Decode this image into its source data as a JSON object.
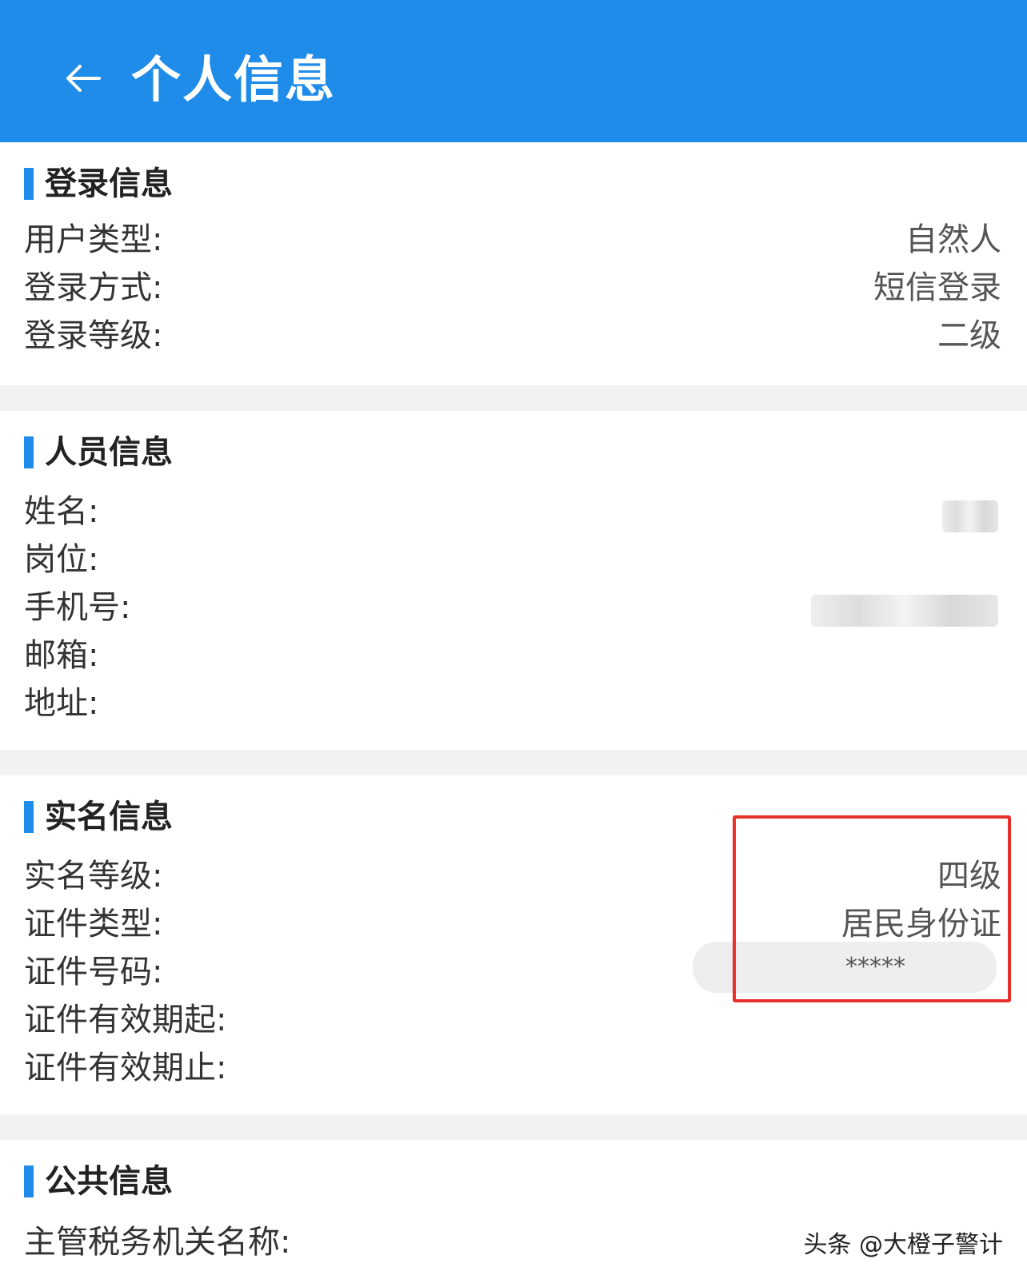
{
  "header": {
    "title": "个人信息"
  },
  "sections": {
    "login": {
      "title": "登录信息",
      "rows": [
        {
          "label": "用户类型:",
          "value": "自然人"
        },
        {
          "label": "登录方式:",
          "value": "短信登录"
        },
        {
          "label": "登录等级:",
          "value": "二级"
        }
      ]
    },
    "person": {
      "title": "人员信息",
      "rows": [
        {
          "label": "姓名:",
          "value": ""
        },
        {
          "label": "岗位:",
          "value": ""
        },
        {
          "label": "手机号:",
          "value": ""
        },
        {
          "label": "邮箱:",
          "value": ""
        },
        {
          "label": "地址:",
          "value": ""
        }
      ]
    },
    "realname": {
      "title": "实名信息",
      "rows": [
        {
          "label": "实名等级:",
          "value": "四级"
        },
        {
          "label": "证件类型:",
          "value": "居民身份证"
        },
        {
          "label": "证件号码:",
          "value": "*****"
        },
        {
          "label": "证件有效期起:",
          "value": ""
        },
        {
          "label": "证件有效期止:",
          "value": ""
        }
      ]
    },
    "public": {
      "title": "公共信息",
      "rows": [
        {
          "label": "主管税务机关名称:",
          "value": ""
        }
      ]
    }
  },
  "watermark": "头条 @大橙子警计",
  "colors": {
    "header": "#1e8ce8",
    "accent_bar": "#1e8ce8",
    "highlight": "#e8302a",
    "gap": "#f2f2f2"
  }
}
